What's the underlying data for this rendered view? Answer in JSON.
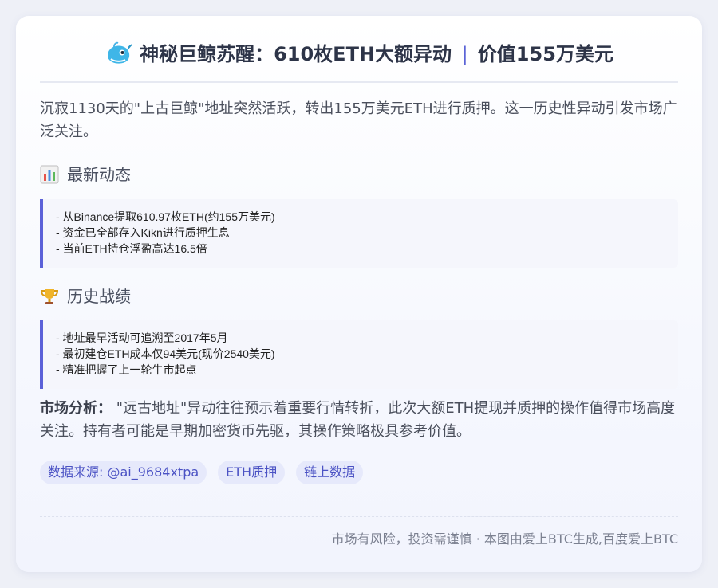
{
  "header": {
    "title_main": "神秘巨鲸苏醒：610枚ETH大额异动",
    "title_sep": "|",
    "title_value": "价值155万美元",
    "icon": "whale-icon"
  },
  "intro": "沉寂1130天的\"上古巨鲸\"地址突然活跃，转出155万美元ETH进行质押。这一历史性异动引发市场广泛关注。",
  "sections": [
    {
      "icon": "bar-chart-icon",
      "title": "最新动态",
      "lines": [
        "- 从Binance提取610.97枚ETH(约155万美元)",
        "- 资金已全部存入Kikn进行质押生息",
        "- 当前ETH持仓浮盈高达16.5倍"
      ]
    },
    {
      "icon": "trophy-icon",
      "title": "历史战绩",
      "lines": [
        "- 地址最早活动可追溯至2017年5月",
        "- 最初建仓ETH成本仅94美元(现价2540美元)",
        "- 精准把握了上一轮牛市起点"
      ]
    }
  ],
  "analysis": {
    "label": "市场分析：",
    "text": " \"远古地址\"异动往往预示着重要行情转折，此次大额ETH提现并质押的操作值得市场高度关注。持有者可能是早期加密货币先驱，其操作策略极具参考价值。"
  },
  "tags": [
    "数据来源: @ai_9684xtpa",
    "ETH质押",
    "链上数据"
  ],
  "footer": "市场有风险，投资需谨慎 · 本图由爱上BTC生成,百度爱上BTC",
  "colors": {
    "accent": "#5b61d8",
    "tag_bg": "#e6e9fb",
    "tag_text": "#4b52c4"
  }
}
